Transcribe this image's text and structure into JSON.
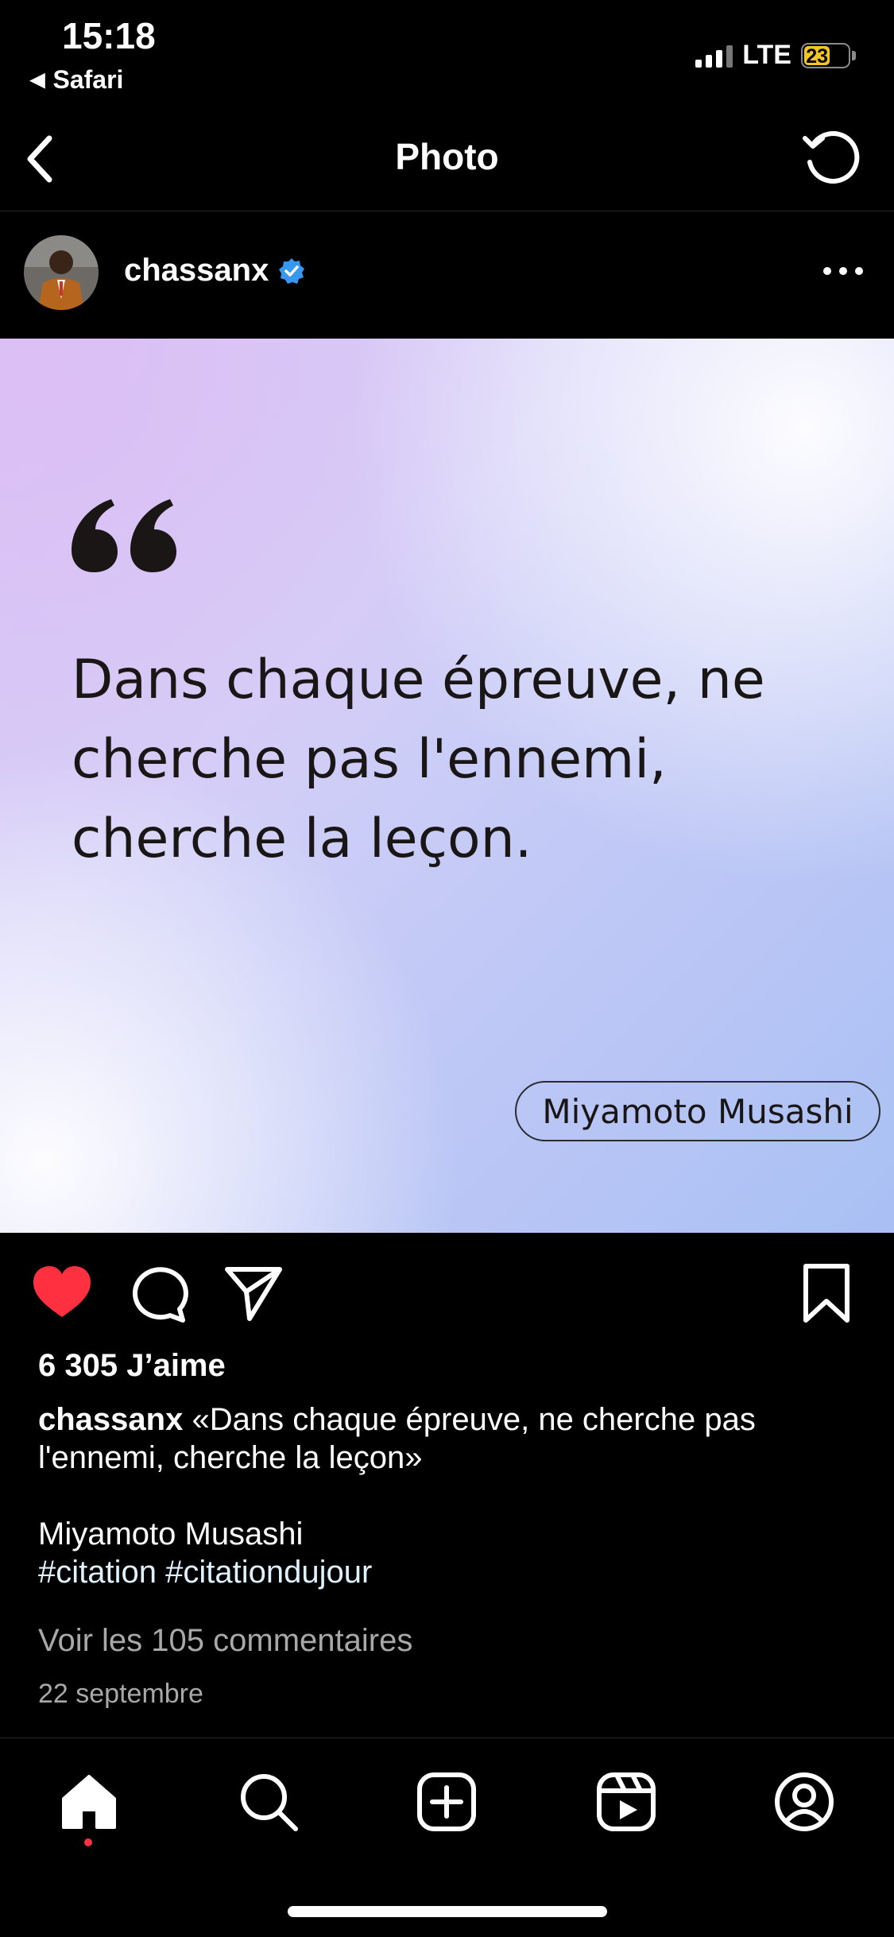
{
  "status_bar": {
    "time": "15:18",
    "back_app": "Safari",
    "network": "LTE",
    "battery": "23",
    "battery_color": "#f3c623"
  },
  "nav": {
    "title": "Photo",
    "back_icon": "chevron-left-icon",
    "refresh_icon": "refresh-icon"
  },
  "post": {
    "username": "chassanx",
    "verified_color": "#3897f0",
    "quote_text": "Dans chaque épreuve, ne cherche pas l'ennemi, cherche la leçon.",
    "quote_author": "Miyamoto Musashi",
    "liked": true,
    "like_color": "#ff3040",
    "likes": "6 305 J’aime",
    "caption_user": "chassanx",
    "caption_text": "«Dans chaque épreuve, ne cherche pas l'ennemi, cherche la leçon»",
    "caption_author": "Miyamoto Musashi",
    "hashtags": [
      "#citation",
      "#citationdujour"
    ],
    "comments_link": "Voir les 105 commentaires",
    "date": "22 septembre"
  },
  "tabbar": {
    "items": [
      "home-icon",
      "search-icon",
      "create-icon",
      "reels-icon",
      "profile-icon"
    ],
    "active": "home-icon"
  }
}
